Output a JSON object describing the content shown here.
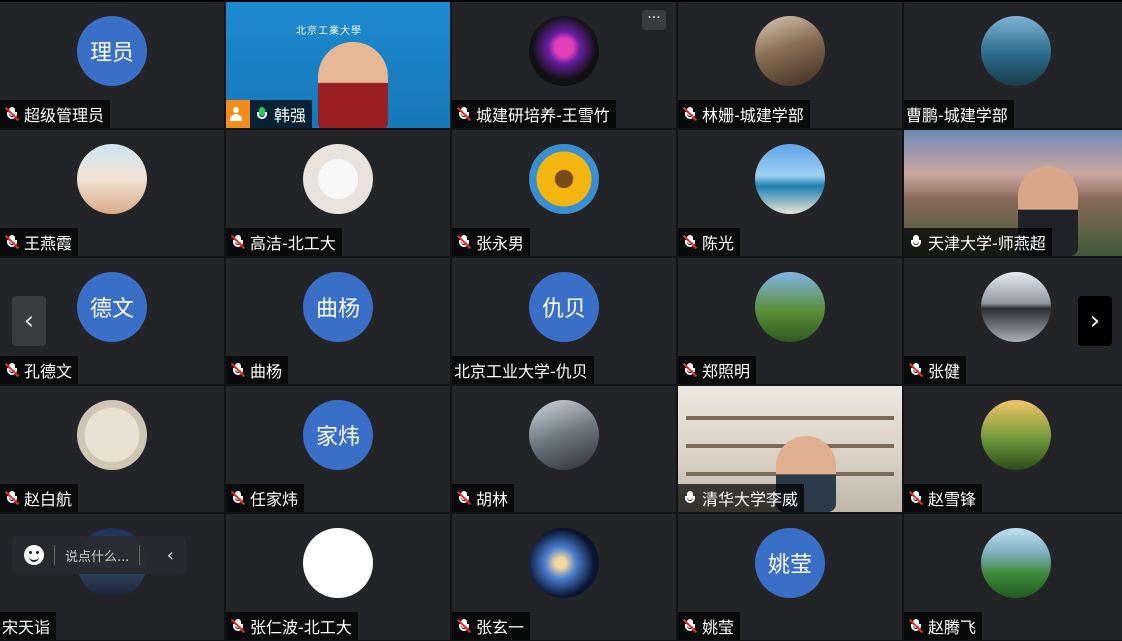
{
  "participants": [
    {
      "name": "超级管理员",
      "avatar_text": "理员",
      "mic": "muted"
    },
    {
      "name": "韩强",
      "avatar_text": "",
      "mic": "on",
      "host": true,
      "video": true
    },
    {
      "name": "城建研培养-王雪竹",
      "avatar_text": "",
      "mic": "muted"
    },
    {
      "name": "林姗-城建学部",
      "avatar_text": "",
      "mic": "muted"
    },
    {
      "name": "曹鹏-城建学部",
      "avatar_text": "",
      "mic": "none"
    },
    {
      "name": "王燕霞",
      "avatar_text": "",
      "mic": "muted"
    },
    {
      "name": "高洁-北工大",
      "avatar_text": "",
      "mic": "muted"
    },
    {
      "name": "张永男",
      "avatar_text": "",
      "mic": "muted"
    },
    {
      "name": "陈光",
      "avatar_text": "",
      "mic": "muted"
    },
    {
      "name": "天津大学-师燕超",
      "avatar_text": "",
      "mic": "on",
      "video": true
    },
    {
      "name": "孔德文",
      "avatar_text": "德文",
      "mic": "muted"
    },
    {
      "name": "曲杨",
      "avatar_text": "曲杨",
      "mic": "muted"
    },
    {
      "name": "北京工业大学-仇贝",
      "avatar_text": "仇贝",
      "mic": "none"
    },
    {
      "name": "郑照明",
      "avatar_text": "",
      "mic": "muted"
    },
    {
      "name": "张健",
      "avatar_text": "",
      "mic": "muted"
    },
    {
      "name": "赵白航",
      "avatar_text": "",
      "mic": "muted"
    },
    {
      "name": "任家炜",
      "avatar_text": "家炜",
      "mic": "muted"
    },
    {
      "name": "胡林",
      "avatar_text": "",
      "mic": "muted"
    },
    {
      "name": "清华大学李威",
      "avatar_text": "",
      "mic": "on",
      "video": true
    },
    {
      "name": "赵雪锋",
      "avatar_text": "",
      "mic": "muted"
    },
    {
      "name": "宋天诣",
      "avatar_text": "",
      "mic": "none"
    },
    {
      "name": "张仁波-北工大",
      "avatar_text": "",
      "mic": "muted"
    },
    {
      "name": "张玄一",
      "avatar_text": "",
      "mic": "muted"
    },
    {
      "name": "姚莹",
      "avatar_text": "姚莹",
      "mic": "muted"
    },
    {
      "name": "赵腾飞",
      "avatar_text": "",
      "mic": "muted"
    }
  ],
  "video_logo_text": "北京工業大學",
  "more_button": "···",
  "nav": {
    "prev": "‹",
    "next": "›"
  },
  "chat": {
    "placeholder": "说点什么...",
    "collapse": "‹"
  },
  "colors": {
    "avatar_text_bg": "#3a6fc8",
    "active_border": "#1fbf8f",
    "host_badge": "#f28c1b",
    "mic_active": "#30c85a",
    "mic_muted_slash": "#e0322f"
  }
}
